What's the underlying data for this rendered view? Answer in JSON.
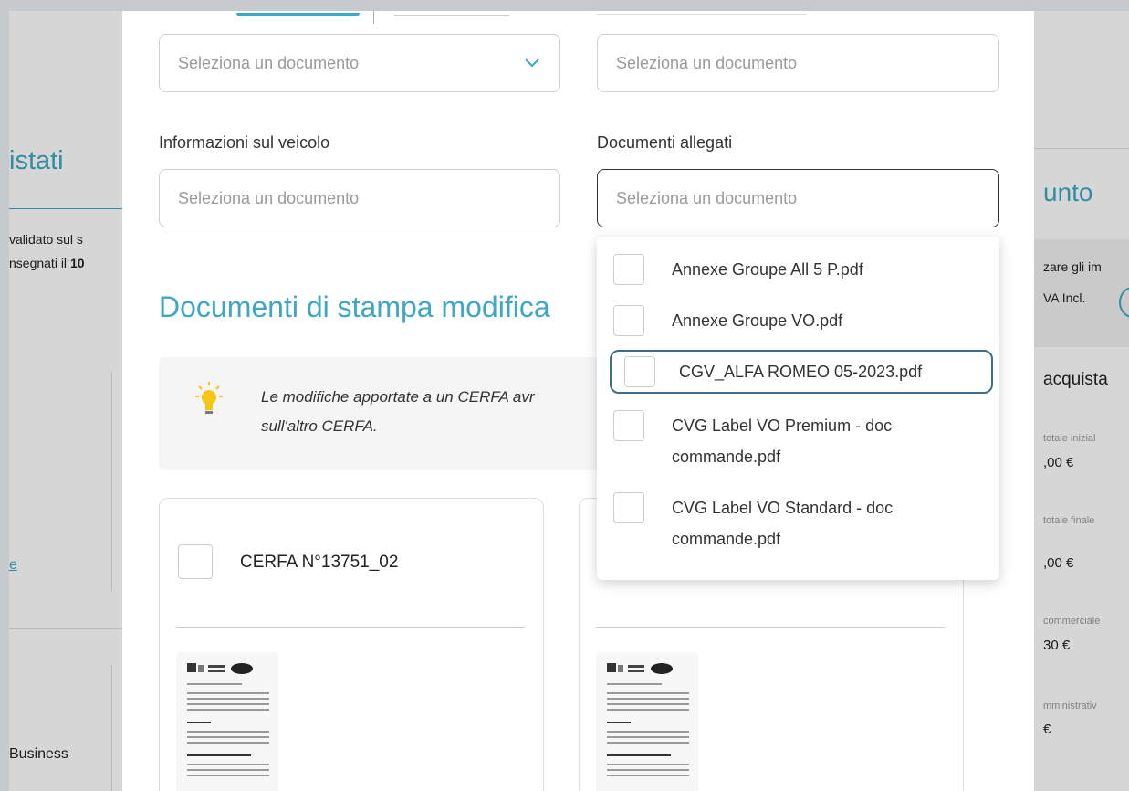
{
  "background": {
    "left_title": "istati",
    "left_text_1": "validato sul s",
    "left_text_2_prefix": "nsegnati il ",
    "left_text_2_bold": "10",
    "left_link": "e",
    "left_business": "Business",
    "right_title": "unto",
    "right_text_1": "zare gli im",
    "right_text_2": "VA Incl.",
    "right_heading": "acquista",
    "right_label_1": "totale inizial",
    "right_value_1": ",00 €",
    "right_label_2": "totale finale",
    "right_value_2": ",00 €",
    "right_label_3": "commerciale",
    "right_value_3": "30 €",
    "right_label_4": "mministrativ",
    "right_value_4": "€"
  },
  "modal": {
    "field_top_left": {
      "placeholder": "Seleziona un documento"
    },
    "field_top_right": {
      "placeholder": "Seleziona un documento"
    },
    "vehicle_info": {
      "label": "Informazioni sul veicolo",
      "placeholder": "Seleziona un documento"
    },
    "attached_docs": {
      "label": "Documenti allegati",
      "placeholder": "Seleziona un documento"
    },
    "section_title": "Documenti di stampa modifica",
    "info_text_line1": "Le modifiche apportate a un CERFA avr",
    "info_text_line2": "sull'altro CERFA.",
    "card_1_label": "CERFA N°13751_02",
    "dropdown_options": [
      {
        "label_line1": "Annexe Groupe All 5 P.pdf",
        "label_line2": ""
      },
      {
        "label_line1": "Annexe Groupe VO.pdf",
        "label_line2": ""
      },
      {
        "label_line1": "CGV_ALFA ROMEO 05-2023.pdf",
        "label_line2": ""
      },
      {
        "label_line1": "CVG Label VO Premium - doc",
        "label_line2": "commande.pdf"
      },
      {
        "label_line1": "CVG Label VO Standard - doc",
        "label_line2": "commande.pdf"
      }
    ]
  },
  "colors": {
    "accent": "#3ea7c2",
    "focus_ring": "#3e6d8a",
    "bulb": "#f5c518"
  }
}
